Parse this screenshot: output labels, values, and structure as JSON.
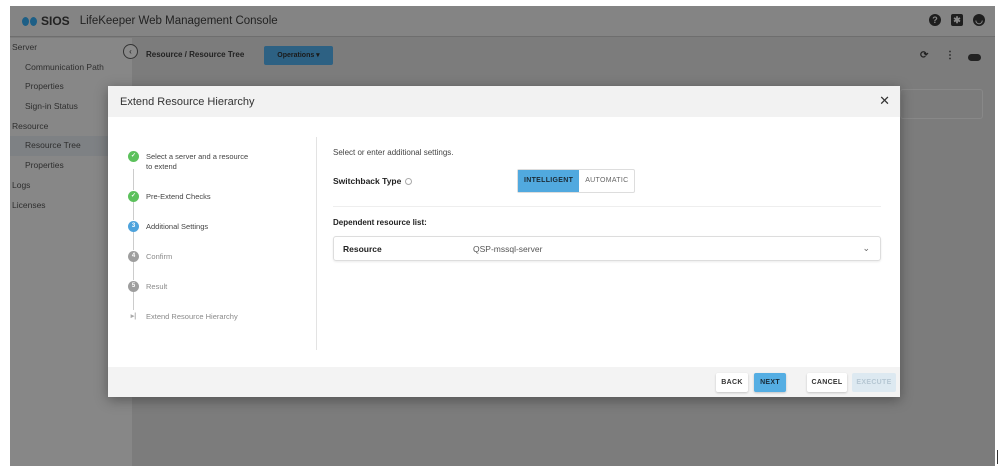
{
  "app": {
    "brand": "SIOS",
    "title": "LifeKeeper Web Management Console"
  },
  "topbar": {
    "icons": [
      "help-icon",
      "gear-icon",
      "user-icon"
    ]
  },
  "sidebar": {
    "items": [
      {
        "label": "Server",
        "level": 0
      },
      {
        "label": "Communication Path",
        "level": 1
      },
      {
        "label": "Properties",
        "level": 1
      },
      {
        "label": "Sign-in Status",
        "level": 1
      },
      {
        "label": "Resource",
        "level": 0
      },
      {
        "label": "Resource Tree",
        "level": 1,
        "active": true
      },
      {
        "label": "Properties",
        "level": 1
      },
      {
        "label": "Logs",
        "level": 0
      },
      {
        "label": "Licenses",
        "level": 0
      }
    ]
  },
  "breadcrumb": "Resource / Resource Tree",
  "operations_label": "Operations ▾",
  "modal": {
    "title": "Extend Resource Hierarchy",
    "steps": [
      {
        "num": "✓",
        "label": "Select a server and a resource to extend",
        "state": "done"
      },
      {
        "num": "✓",
        "label": "Pre-Extend Checks",
        "state": "done"
      },
      {
        "num": "3",
        "label": "Additional Settings",
        "state": "current"
      },
      {
        "num": "4",
        "label": "Confirm",
        "state": "todo"
      },
      {
        "num": "5",
        "label": "Result",
        "state": "todo"
      }
    ],
    "final_step": "Extend Resource Hierarchy",
    "description": "Select or enter additional settings.",
    "switchback_label": "Switchback Type",
    "switchback_options": [
      "INTELLIGENT",
      "AUTOMATIC"
    ],
    "switchback_selected": "INTELLIGENT",
    "dependent_label": "Dependent resource list:",
    "dependent": {
      "key": "Resource",
      "value": "QSP-mssql-server"
    },
    "buttons": {
      "back": "BACK",
      "next": "NEXT",
      "cancel": "CANCEL",
      "execute": "EXECUTE"
    }
  }
}
